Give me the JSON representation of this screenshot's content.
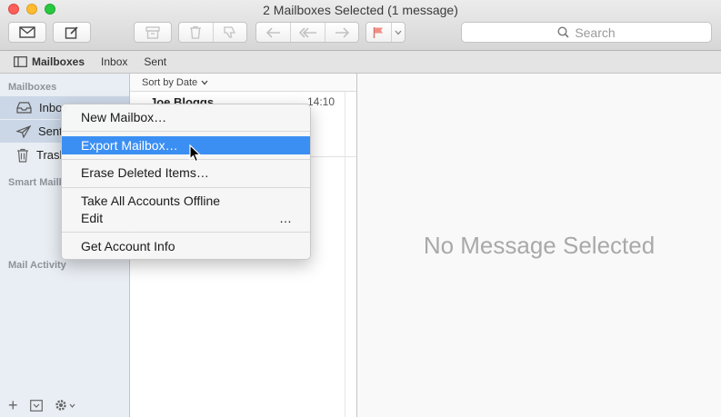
{
  "window": {
    "title": "2 Mailboxes Selected (1 message)"
  },
  "toolbar": {
    "get_mail_icon": "envelope-icon",
    "compose_icon": "compose-icon",
    "search_placeholder": "Search"
  },
  "favorites": {
    "mailboxes_label": "Mailboxes",
    "items": [
      "Inbox",
      "Sent"
    ]
  },
  "sidebar": {
    "section_mailboxes": "Mailboxes",
    "items": [
      {
        "label": "Inbox",
        "icon": "inbox-tray-icon"
      },
      {
        "label": "Sent",
        "icon": "paper-plane-icon"
      },
      {
        "label": "Trash",
        "icon": "trash-icon"
      }
    ],
    "section_smart": "Smart Mailboxes",
    "section_activity": "Mail Activity",
    "footer": {
      "add": "+",
      "settings_icon": "gear-icon"
    }
  },
  "message_list": {
    "sort_label": "Sort by Date",
    "messages": [
      {
        "sender": "Joe Bloggs",
        "time": "14:10"
      }
    ]
  },
  "viewer": {
    "empty_text": "No Message Selected"
  },
  "context_menu": {
    "items": [
      "New Mailbox…",
      "Export Mailbox…",
      "Erase Deleted Items…",
      "Take All Accounts Offline",
      "Edit",
      "Get Account Info"
    ],
    "edit_suffix": "…",
    "highlighted_index": 1
  },
  "colors": {
    "highlight": "#3b8ff3",
    "selection": "#cbd7e6"
  }
}
